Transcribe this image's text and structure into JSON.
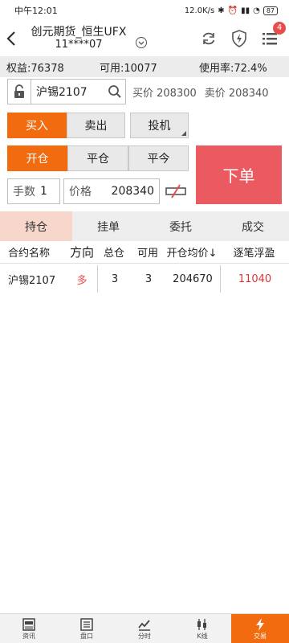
{
  "status": {
    "time": "中午12:01",
    "speed": "12.0K/s",
    "battery": "87"
  },
  "header": {
    "title_line1": "创元期货_恒生UFX",
    "title_line2": "11****07",
    "badge_count": "4"
  },
  "account": {
    "equity": "权益:76378",
    "available": "可用:10077",
    "usage": "使用率:72.4%"
  },
  "contract": {
    "name": "沪锡2107",
    "buy_price": "买价 208300",
    "sell_price": "卖价 208340"
  },
  "trade": {
    "buy": "买入",
    "sell": "卖出",
    "speculate": "投机",
    "open": "开仓",
    "close": "平仓",
    "close_today": "平今",
    "order": "下单",
    "qty_label": "手数",
    "qty_value": "1",
    "price_label": "价格",
    "price_value": "208340"
  },
  "tabs": [
    "持仓",
    "挂单",
    "委托",
    "成交"
  ],
  "table": {
    "headers": [
      "合约名称",
      "方向",
      "总仓",
      "可用",
      "开仓均价↓",
      "逐笔浮盈"
    ],
    "rows": [
      {
        "name": "沪锡2107",
        "direction": "多",
        "total": "3",
        "available": "3",
        "avg_price": "204670",
        "profit": "11040"
      }
    ]
  },
  "bottom_nav": [
    "资讯",
    "盘口",
    "分时",
    "K线",
    "交易"
  ],
  "colors": {
    "accent": "#f26b0f",
    "order_button": "#ec5a61",
    "active_tab": "#f7d6cb",
    "profit": "#d9353a"
  }
}
